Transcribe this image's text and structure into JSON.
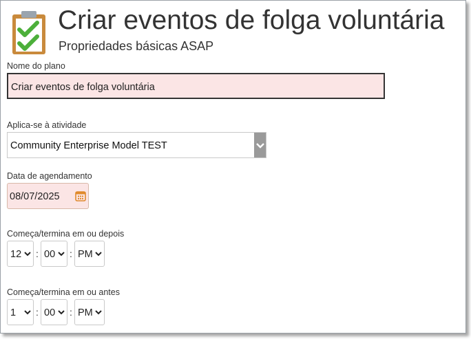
{
  "header": {
    "title": "Criar eventos de folga voluntária",
    "subtitle": "Propriedades básicas ASAP",
    "icon": "clipboard-checklist-icon"
  },
  "form": {
    "plan_name": {
      "label": "Nome do plano",
      "value": "Criar eventos de folga voluntária"
    },
    "activity": {
      "label": "Aplica-se à atividade",
      "value": "Community Enterprise Model TEST"
    },
    "schedule_date": {
      "label": "Data de agendamento",
      "value": "08/07/2025"
    },
    "start_after": {
      "label": "Começa/termina em ou depois",
      "hour": "12",
      "minute": "00",
      "ampm": "PM"
    },
    "end_before": {
      "label": "Começa/termina em ou antes",
      "hour": "1",
      "minute": "00",
      "ampm": "PM"
    },
    "separator": ":"
  },
  "colors": {
    "required_bg": "#fbe5e5",
    "check_green": "#4caf3a",
    "clipboard": "#c98a3c",
    "calendar": "#e08a2c"
  }
}
